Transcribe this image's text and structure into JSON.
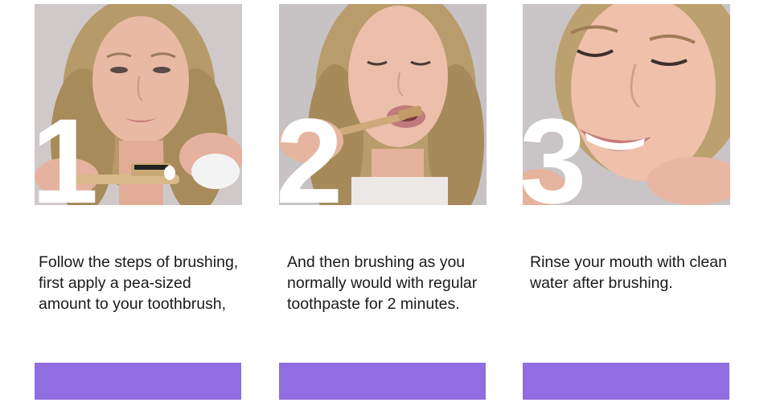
{
  "steps": [
    {
      "number": "1",
      "caption": "Follow the steps of brushing, first apply a pea-sized amount to your toothbrush,"
    },
    {
      "number": "2",
      "caption": "And then brushing as you normally would with regular toothpaste for 2 minutes."
    },
    {
      "number": "3",
      "caption": "Rinse your mouth with clean water after brushing."
    }
  ],
  "colors": {
    "accent_bar": "#8e6ee0",
    "text": "#1a1a1a",
    "numeral": "#ffffff"
  }
}
